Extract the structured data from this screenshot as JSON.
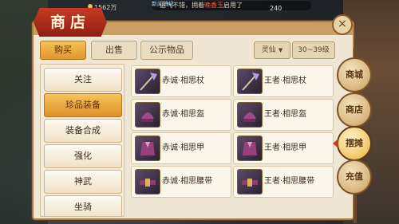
{
  "topbar": {
    "money": "1562万",
    "ticker_prefix": "运气不错，拥着",
    "ticker_highlight": "晚香玉",
    "ticker_suffix": "启用了",
    "system_msg": "新闻消息",
    "num": "240"
  },
  "shop": {
    "title": "商店",
    "close_icon": "×",
    "tabs": [
      {
        "label": "购买",
        "active": true
      },
      {
        "label": "出售",
        "active": false
      },
      {
        "label": "公示物品",
        "active": false
      }
    ],
    "filters": [
      {
        "label": "灵仙",
        "caret": "▼"
      },
      {
        "label": "30~39级"
      }
    ],
    "categories": [
      {
        "label": "关注",
        "active": false
      },
      {
        "label": "珍品装备",
        "active": true
      },
      {
        "label": "装备合成",
        "active": false
      },
      {
        "label": "强化",
        "active": false
      },
      {
        "label": "神武",
        "active": false
      },
      {
        "label": "坐骑",
        "active": false
      }
    ],
    "items": [
      {
        "name": "赤诚·相思杖",
        "tag": "",
        "icon": "staff-icon"
      },
      {
        "name": "王者·相思杖",
        "tag": "",
        "icon": "staff-icon"
      },
      {
        "name": "赤诚·相思盔",
        "tag": "",
        "icon": "helmet-icon"
      },
      {
        "name": "王者·相思盔",
        "tag": "",
        "icon": "helmet-icon"
      },
      {
        "name": "赤诚·相思甲",
        "tag": "",
        "icon": "armor-icon"
      },
      {
        "name": "王者·相思甲",
        "tag": "",
        "icon": "armor-icon"
      },
      {
        "name": "赤诚·相思腰带",
        "tag": "",
        "icon": "belt-icon"
      },
      {
        "name": "王者·相思腰带",
        "tag": "",
        "icon": "belt-icon"
      }
    ]
  },
  "side_menu": [
    {
      "label": "商城",
      "active": false
    },
    {
      "label": "商店",
      "active": false
    },
    {
      "label": "摆摊",
      "active": true
    },
    {
      "label": "充值",
      "active": false
    }
  ],
  "colors": {
    "accent": "#e1962b",
    "title_red": "#c63a22",
    "frame": "#a97a44"
  }
}
